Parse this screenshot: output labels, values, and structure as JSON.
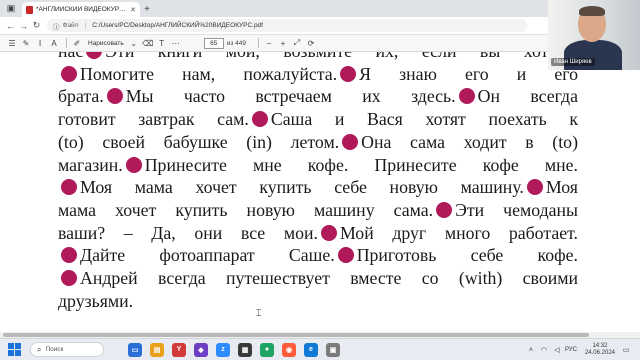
{
  "browser": {
    "tab_title": "*АНГЛИЙСКИЙ ВИДЕОКУРС.pdf",
    "new_tab_label": "+",
    "address_prefix": "Файл",
    "url": "C:/Users/PC/Desktop/АНГЛИЙСКИЙ%20ВИДЕОКУРС.pdf"
  },
  "pdf_toolbar": {
    "draw_label": "Нарисовать",
    "current_page": "65",
    "page_count": "из 449"
  },
  "webcam": {
    "person_name": "Иван Ширяев"
  },
  "document": {
    "lines": [
      {
        "parts": [
          "нас",
          "dot",
          "Эти книги мои, возьмите их, если вы хотите."
        ]
      },
      {
        "parts": [
          "dot",
          "Помогите нам, пожалуйста.",
          "dot",
          "Я знаю его и его"
        ]
      },
      {
        "parts": [
          "брата.",
          "dot",
          "Мы часто встречаем их здесь.",
          "dot",
          "Он всегда"
        ]
      },
      {
        "parts": [
          "готовит завтрак сам.",
          "dot",
          "Саша и Вася хотят поехать к"
        ]
      },
      {
        "parts": [
          "(to) своей бабушке (in) летом.",
          "dot",
          "Она сама ходит в (to)"
        ]
      },
      {
        "parts": [
          "магазин.",
          "dot",
          "Принесите мне кофе. Принесите кофе мне."
        ]
      },
      {
        "parts": [
          "dot",
          "Моя мама хочет купить себе новую машину.",
          "dot",
          "Моя"
        ]
      },
      {
        "parts": [
          "мама хочет купить новую машину сама.",
          "dot",
          "Эти чемоданы"
        ]
      },
      {
        "parts": [
          "ваши? – Да, они все мои.",
          "dot",
          "Мой друг много работает."
        ]
      },
      {
        "parts": [
          "dot",
          "Дайте фотоаппарат Саше.",
          "dot",
          "Приготовь себе кофе."
        ]
      },
      {
        "parts": [
          "dot",
          "Андрей всегда путешествует вместе со  (with) своими"
        ]
      },
      {
        "parts": [
          "друзьями."
        ]
      }
    ]
  },
  "taskbar": {
    "search_placeholder": "Поиск",
    "language": "РУС",
    "time": "14:32",
    "date": "24.06.2024"
  },
  "colors": {
    "bullet": "#b0195a",
    "windows_accent": "#1a73d9"
  }
}
